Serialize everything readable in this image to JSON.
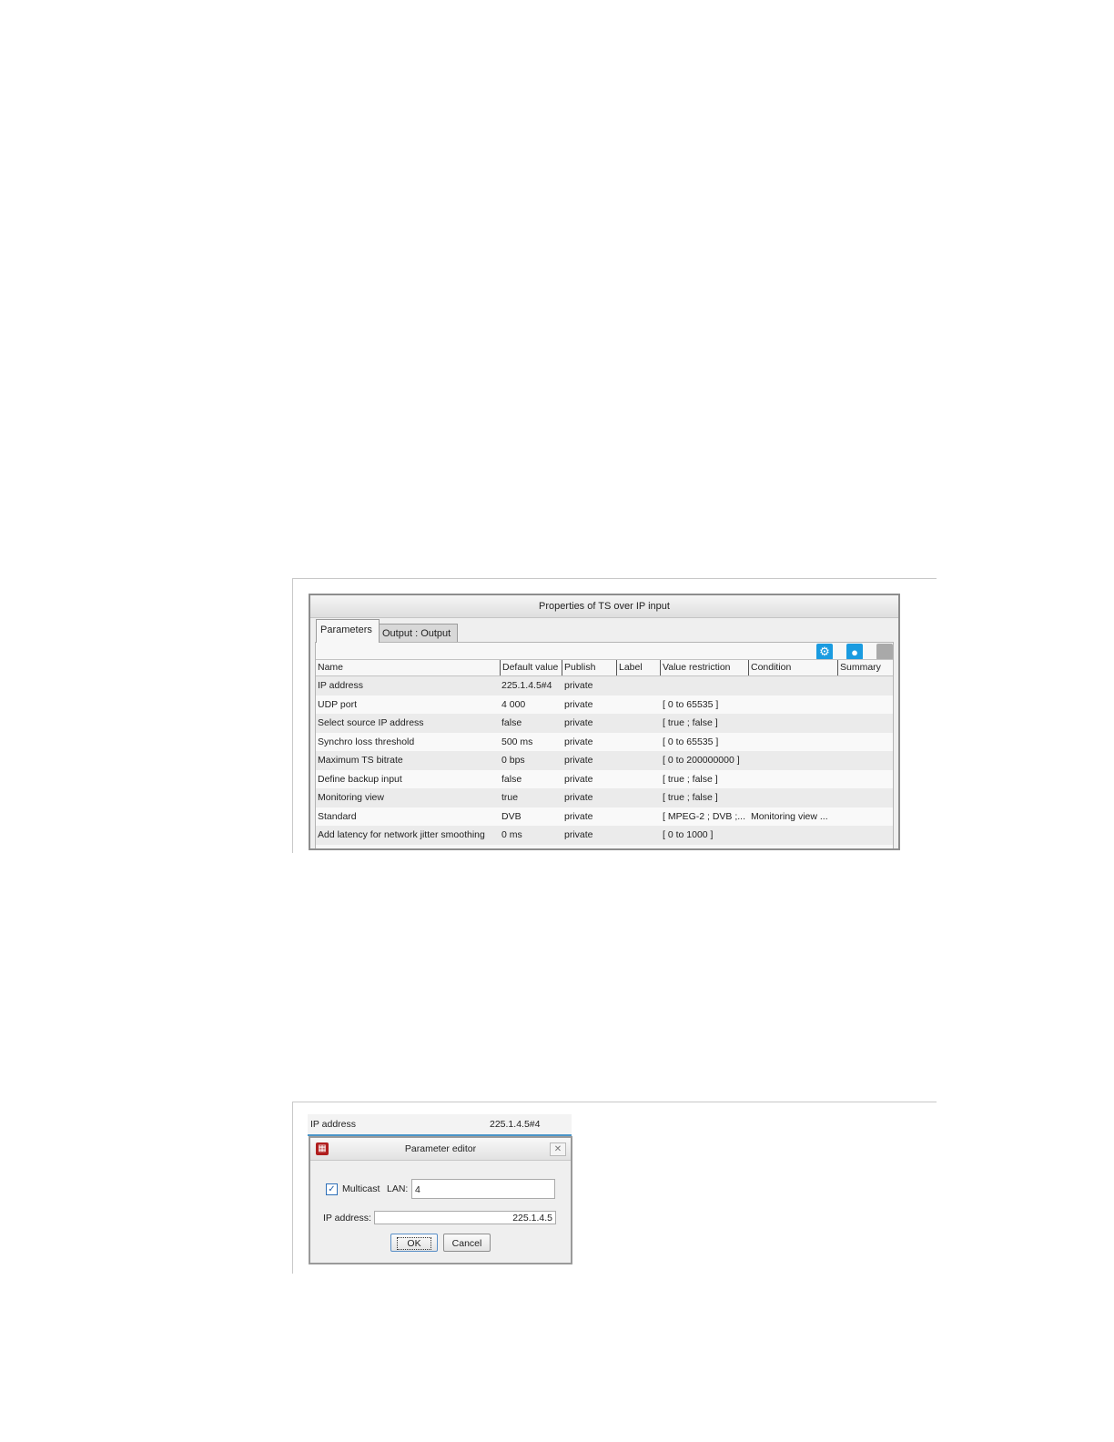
{
  "properties_window": {
    "title": "Properties of TS over IP input",
    "tabs": [
      {
        "label": "Parameters",
        "active": true
      },
      {
        "label": "Output : Output",
        "active": false
      }
    ],
    "toolbar_icons": [
      "gear-icon",
      "user-icon",
      "disabled-icon"
    ],
    "columns": [
      "Name",
      "Default value",
      "Publish",
      "Label",
      "Value restriction",
      "Condition",
      "Summary"
    ],
    "rows": [
      {
        "name": "IP address",
        "default": "225.1.4.5#4",
        "publish": "private",
        "label": "",
        "restriction": "",
        "condition": "",
        "summary": ""
      },
      {
        "name": "UDP port",
        "default": "4 000",
        "publish": "private",
        "label": "",
        "restriction": "[ 0 to 65535 ]",
        "condition": "",
        "summary": ""
      },
      {
        "name": "Select source IP address",
        "default": "false",
        "publish": "private",
        "label": "",
        "restriction": "[ true ; false ]",
        "condition": "",
        "summary": ""
      },
      {
        "name": "Synchro loss threshold",
        "default": "500 ms",
        "publish": "private",
        "label": "",
        "restriction": "[ 0 to 65535 ]",
        "condition": "",
        "summary": ""
      },
      {
        "name": "Maximum TS bitrate",
        "default": "0 bps",
        "publish": "private",
        "label": "",
        "restriction": "[ 0 to 200000000 ]",
        "condition": "",
        "summary": ""
      },
      {
        "name": "Define backup input",
        "default": "false",
        "publish": "private",
        "label": "",
        "restriction": "[ true ; false ]",
        "condition": "",
        "summary": ""
      },
      {
        "name": "Monitoring view",
        "default": "true",
        "publish": "private",
        "label": "",
        "restriction": "[ true ; false ]",
        "condition": "",
        "summary": ""
      },
      {
        "name": "Standard",
        "default": "DVB",
        "publish": "private",
        "label": "",
        "restriction": "[ MPEG-2 ; DVB ;...",
        "condition": "Monitoring view  ...",
        "summary": ""
      },
      {
        "name": "Add latency for network jitter smoothing",
        "default": "0 ms",
        "publish": "private",
        "label": "",
        "restriction": "[ 0 to 1000 ]",
        "condition": "",
        "summary": ""
      }
    ]
  },
  "editor_figure": {
    "row_label": "IP address",
    "row_value": "225.1.4.5#4",
    "dialog": {
      "title": "Parameter editor",
      "multicast_label": "Multicast",
      "multicast_checked": true,
      "lan_label": "LAN:",
      "lan_value": "4",
      "ip_label": "IP address:",
      "ip_value": "225.1.4.5",
      "ok_label": "OK",
      "cancel_label": "Cancel"
    }
  },
  "colors": {
    "accent": "#1a9be0",
    "app_icon": "#b01e1e",
    "selection_line": "#4a95c8"
  }
}
